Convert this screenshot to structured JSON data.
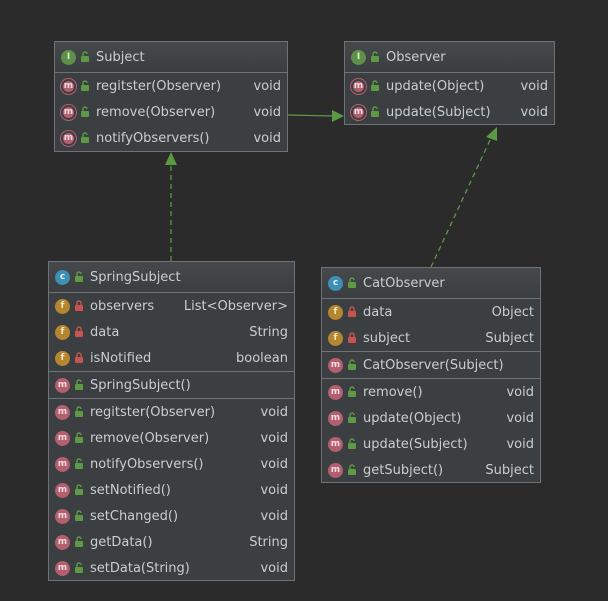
{
  "subject": {
    "kind_icon": "interface-icon",
    "name": "Subject",
    "methods": [
      {
        "name": "regitster(Observer)",
        "type": "void"
      },
      {
        "name": "remove(Observer)",
        "type": "void"
      },
      {
        "name": "notifyObservers()",
        "type": "void"
      }
    ]
  },
  "observer": {
    "kind_icon": "interface-icon",
    "name": "Observer",
    "methods": [
      {
        "name": "update(Object)",
        "type": "void"
      },
      {
        "name": "update(Subject)",
        "type": "void"
      }
    ]
  },
  "spring_subject": {
    "kind_icon": "class-icon",
    "name": "SpringSubject",
    "fields": [
      {
        "name": "observers",
        "type": "List<Observer>"
      },
      {
        "name": "data",
        "type": "String"
      },
      {
        "name": "isNotified",
        "type": "boolean"
      }
    ],
    "constructors": [
      {
        "name": "SpringSubject()"
      }
    ],
    "methods": [
      {
        "name": "regitster(Observer)",
        "type": "void"
      },
      {
        "name": "remove(Observer)",
        "type": "void"
      },
      {
        "name": "notifyObservers()",
        "type": "void"
      },
      {
        "name": "setNotified()",
        "type": "void"
      },
      {
        "name": "setChanged()",
        "type": "void"
      },
      {
        "name": "getData()",
        "type": "String"
      },
      {
        "name": "setData(String)",
        "type": "void"
      }
    ]
  },
  "cat_observer": {
    "kind_icon": "class-icon",
    "name": "CatObserver",
    "fields": [
      {
        "name": "data",
        "type": "Object"
      },
      {
        "name": "subject",
        "type": "Subject"
      }
    ],
    "constructors": [
      {
        "name": "CatObserver(Subject)"
      }
    ],
    "methods": [
      {
        "name": "remove()",
        "type": "void"
      },
      {
        "name": "update(Object)",
        "type": "void"
      },
      {
        "name": "update(Subject)",
        "type": "void"
      },
      {
        "name": "getSubject()",
        "type": "Subject"
      }
    ]
  },
  "colors": {
    "background": "#2b2b2b",
    "box": "#3c3f41",
    "border": "#6e7275",
    "text": "#c9cdd1",
    "arrow": "#5b9a45"
  }
}
